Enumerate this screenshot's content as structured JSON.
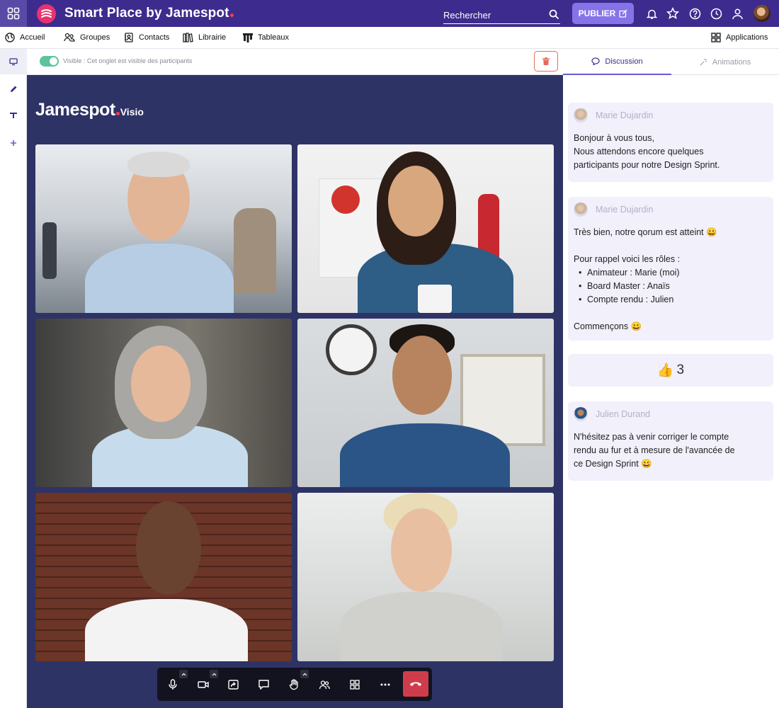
{
  "header": {
    "brand_title": "Smart Place by Jamespot",
    "search_placeholder": "Rechercher",
    "publish_label": "PUBLIER"
  },
  "nav": {
    "items": [
      {
        "label": "Accueil",
        "icon": "globe-icon"
      },
      {
        "label": "Groupes",
        "icon": "groups-icon"
      },
      {
        "label": "Contacts",
        "icon": "contacts-icon"
      },
      {
        "label": "Librairie",
        "icon": "library-icon"
      },
      {
        "label": "Tableaux",
        "icon": "boards-icon"
      }
    ],
    "applications_label": "Applications"
  },
  "toolbar": {
    "visible_label": "Visible : Cet onglet est visible des participants",
    "visible_on": true
  },
  "stage": {
    "logo_main": "Jamespot",
    "logo_sub": "Visio"
  },
  "panel": {
    "tabs": [
      {
        "label": "Discussion",
        "active": true
      },
      {
        "label": "Animations",
        "active": false
      }
    ],
    "messages": [
      {
        "author": "Marie Dujardin",
        "lines": [
          "Bonjour à vous tous,",
          "Nous attendons encore quelques",
          "participants pour notre Design Sprint."
        ]
      },
      {
        "author": "Marie Dujardin",
        "line1": "Très bien, notre qorum est atteint 😀",
        "line2": "Pour rappel voici les rôles :",
        "bullets": [
          "Animateur : Marie  (moi)",
          "Board Master : Anaïs",
          "Compte rendu : Julien"
        ],
        "line3": "Commençons 😀"
      },
      {
        "author": "Julien Durand",
        "lines": [
          "N'hésitez pas à venir corriger le compte",
          "rendu au fur et à mesure de l'avancée de",
          "ce Design Sprint 😀"
        ]
      }
    ],
    "reaction": {
      "emoji": "👍",
      "count": "3"
    }
  },
  "colors": {
    "brand": "#3d2c8d",
    "accent": "#8574e8",
    "stage": "#2e3366",
    "hangup": "#cf3d4c",
    "toggle_on": "#5cc39a"
  }
}
